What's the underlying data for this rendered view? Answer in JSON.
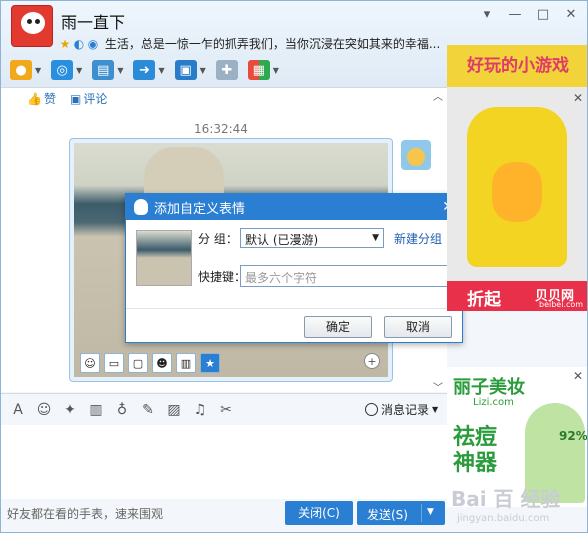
{
  "header": {
    "nickname": "雨一直下",
    "signature": "生活，总是一惊一乍的抓弄我们，当你沉浸在突如其来的幸福..."
  },
  "window_controls": {
    "menu": "▾",
    "minimize": "—",
    "maximize": "□",
    "close": "✕"
  },
  "toolbar": {
    "items": [
      "voice-call",
      "video-call",
      "remote-desktop",
      "file-transfer",
      "screen-share",
      "send-message",
      "app-center"
    ]
  },
  "chat": {
    "like_label": "赞",
    "comment_label": "评论",
    "timestamp": "16:32:44"
  },
  "dialog": {
    "title": "添加自定义表情",
    "group_label": "分  组：",
    "group_value": "默认 (已漫游)",
    "new_group_link": "新建分组",
    "shortcut_label": "快捷键：",
    "shortcut_placeholder": "最多六个字符",
    "ok_button": "确定",
    "cancel_button": "取消"
  },
  "input_toolbar": {
    "history_label": "消息记录"
  },
  "footer": {
    "status_text": "好友都在看的手表，速来围观",
    "close_button": "关闭(C)",
    "send_button": "发送(S)"
  },
  "ads": {
    "games_banner": "好玩的小游戏",
    "beibei_slogan": "折起",
    "beibei_brand": "贝贝网",
    "beibei_domain": "beibei.com",
    "lizi_brand": "丽子美妆",
    "lizi_domain": "Lizi.com",
    "lizi_tagline": "祛痘神器",
    "lizi_percent": "92%"
  },
  "watermark": {
    "logo": "Bai 百 经验",
    "url": "jingyan.baidu.com"
  },
  "colors": {
    "accent": "#2b7fd3",
    "link": "#1f5fb0",
    "window_bg": "#f3f7fb"
  }
}
